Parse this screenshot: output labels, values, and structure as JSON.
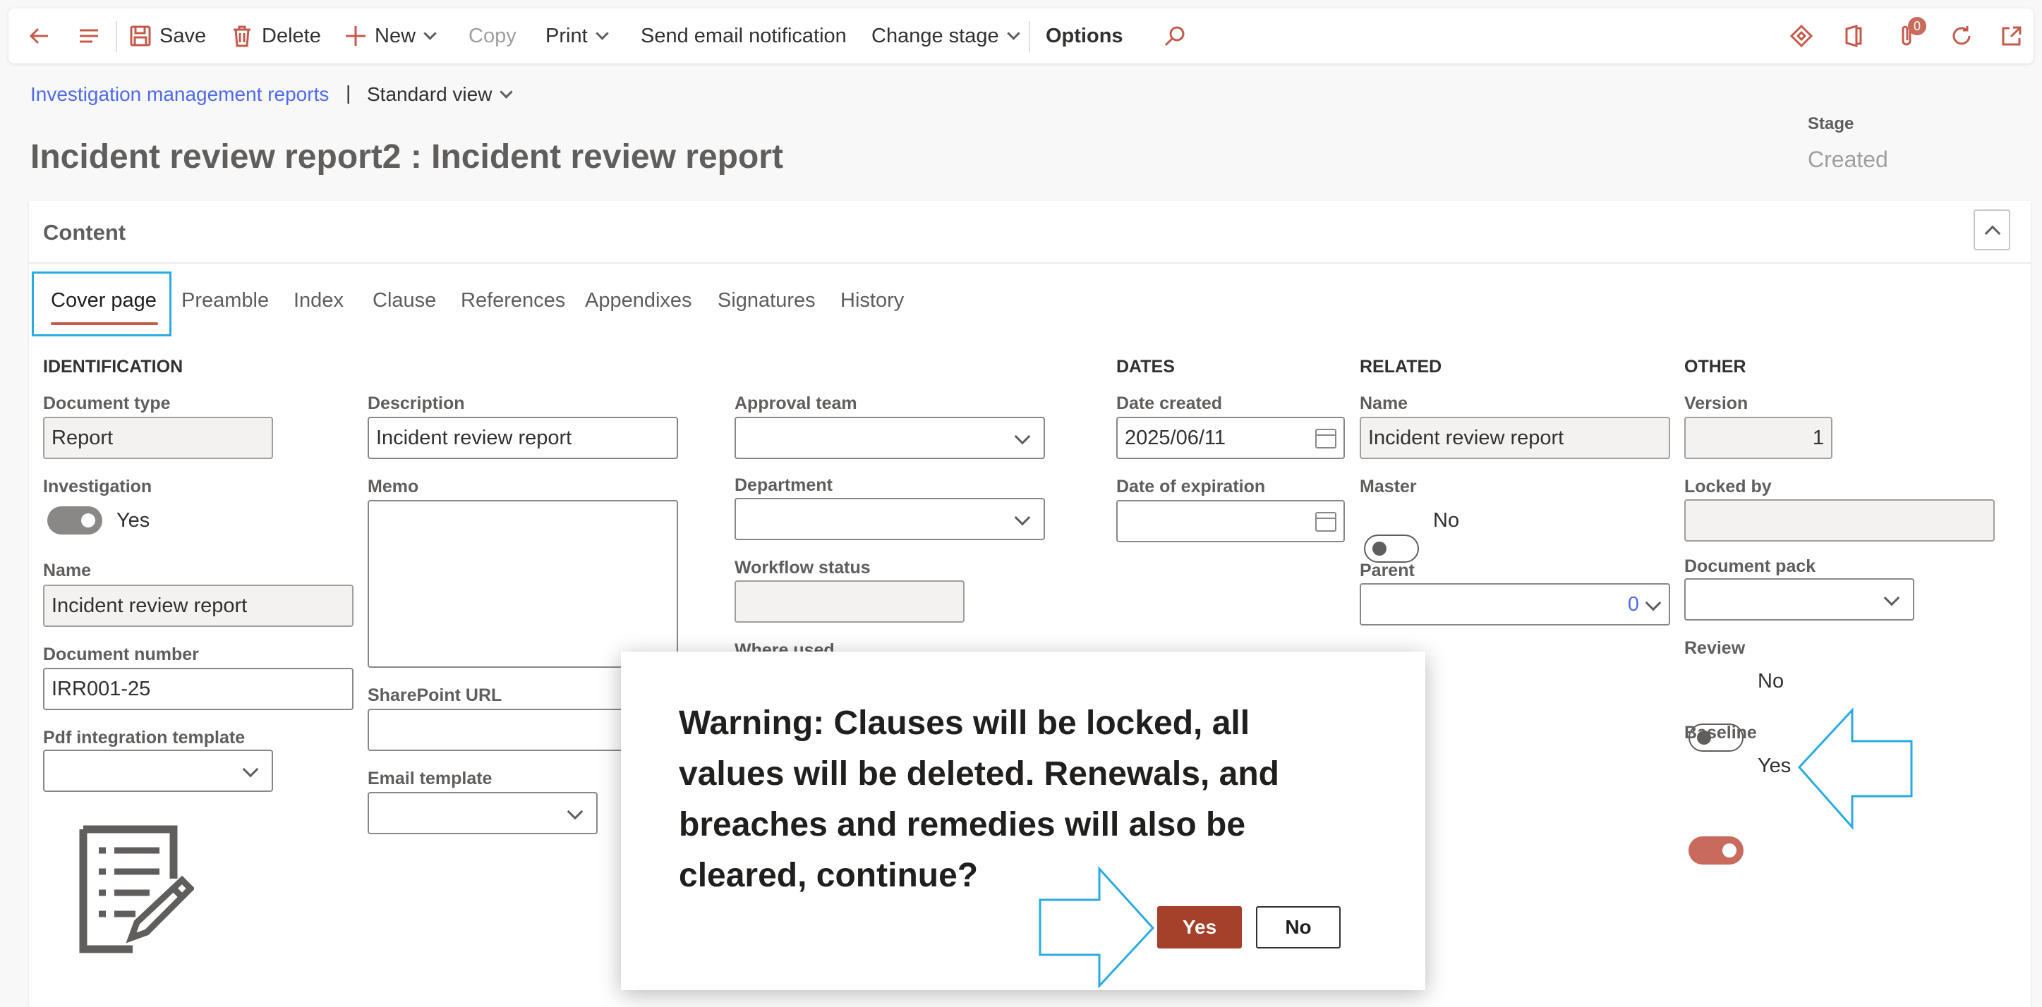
{
  "toolbar": {
    "save": "Save",
    "delete": "Delete",
    "new": "New",
    "copy": "Copy",
    "print": "Print",
    "send_email": "Send email notification",
    "change_stage": "Change stage",
    "options": "Options",
    "attachments_count": "0"
  },
  "breadcrumb": {
    "link": "Investigation management reports",
    "separator": "|",
    "view": "Standard view"
  },
  "page_title": "Incident review report2 : Incident review report",
  "stage": {
    "label": "Stage",
    "value": "Created"
  },
  "panel": {
    "title": "Content"
  },
  "tabs": [
    "Cover page",
    "Preamble",
    "Index",
    "Clause",
    "References",
    "Appendixes",
    "Signatures",
    "History"
  ],
  "identification": {
    "heading": "IDENTIFICATION",
    "document_type_label": "Document type",
    "document_type": "Report",
    "investigation_label": "Investigation",
    "investigation_value": "Yes",
    "name_label": "Name",
    "name": "Incident review report",
    "document_number_label": "Document number",
    "document_number": "IRR001-25",
    "pdf_template_label": "Pdf integration template"
  },
  "col2": {
    "description_label": "Description",
    "description": "Incident review report",
    "memo_label": "Memo",
    "sharepoint_label": "SharePoint URL",
    "email_template_label": "Email template"
  },
  "col3": {
    "approval_team_label": "Approval team",
    "department_label": "Department",
    "workflow_status_label": "Workflow status",
    "where_used_label": "Where used"
  },
  "dates": {
    "heading": "DATES",
    "created_label": "Date created",
    "created": "2025/06/11",
    "expiration_label": "Date of expiration"
  },
  "related": {
    "heading": "RELATED",
    "name_label": "Name",
    "name": "Incident review report",
    "master_label": "Master",
    "master_value": "No",
    "parent_label": "Parent",
    "parent": "0"
  },
  "other": {
    "heading": "OTHER",
    "version_label": "Version",
    "version": "1",
    "locked_by_label": "Locked by",
    "document_pack_label": "Document pack",
    "review_label": "Review",
    "review_value": "No",
    "baseline_label": "Baseline",
    "baseline_value": "Yes"
  },
  "dialog": {
    "message": "Warning: Clauses will be locked, all values will be deleted. Renewals, and breaches and remedies will also be cleared, continue?",
    "yes": "Yes",
    "no": "No"
  },
  "colors": {
    "accent_red": "#a5402a",
    "link_blue": "#4f6bed",
    "annotation_blue": "#29abe2"
  }
}
